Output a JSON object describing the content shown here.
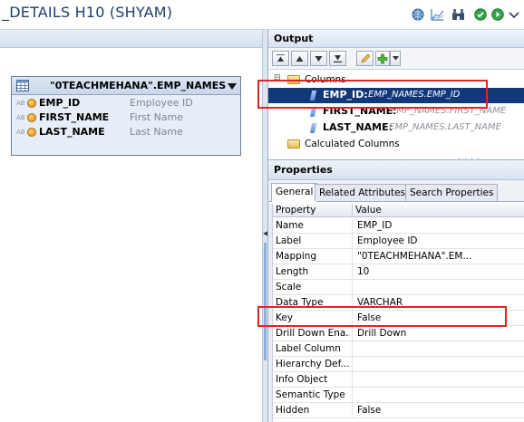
{
  "editor": {
    "title": "_DETAILS H10 (SHYAM)",
    "toolbar_icons": [
      "globe-icon",
      "chart-icon",
      "binoculars-icon",
      "check-icon",
      "run-icon",
      "menu-icon"
    ]
  },
  "canvas": {
    "table_node": {
      "title": "\"0TEACHMEHANA\".EMP_NAMES",
      "columns": [
        {
          "name": "EMP_ID",
          "label": "Employee ID",
          "type_glyph": "AB"
        },
        {
          "name": "FIRST_NAME",
          "label": "First Name",
          "type_glyph": "AB"
        },
        {
          "name": "LAST_NAME",
          "label": "Last Name",
          "type_glyph": "AB"
        }
      ]
    }
  },
  "output": {
    "title": "Output",
    "tree": {
      "columns_folder": "Columns",
      "columns": [
        {
          "name": "EMP_ID:",
          "mapping": "EMP_NAMES.EMP_ID",
          "selected": true
        },
        {
          "name": "FIRST_NAME:",
          "mapping": "EMP_NAMES.FIRST_NAME",
          "selected": false
        },
        {
          "name": "LAST_NAME:",
          "mapping": "EMP_NAMES.LAST_NAME",
          "selected": false
        }
      ],
      "calculated_folder": "Calculated Columns"
    }
  },
  "properties": {
    "title": "Properties",
    "tabs": [
      "General",
      "Related Attributes",
      "Search Properties"
    ],
    "active_tab": "General",
    "headers": {
      "property": "Property",
      "value": "Value"
    },
    "rows": [
      {
        "property": "Name",
        "value": "EMP_ID"
      },
      {
        "property": "Label",
        "value": "Employee ID"
      },
      {
        "property": "Mapping",
        "value": "\"0TEACHMEHANA\".EM..."
      },
      {
        "property": "Length",
        "value": "10"
      },
      {
        "property": "Scale",
        "value": ""
      },
      {
        "property": "Data Type",
        "value": "VARCHAR"
      },
      {
        "property": "Key",
        "value": "False"
      },
      {
        "property": "Drill Down Ena...",
        "value": "Drill Down"
      },
      {
        "property": "Label Column",
        "value": ""
      },
      {
        "property": "Hierarchy Def...",
        "value": ""
      },
      {
        "property": "Info Object",
        "value": ""
      },
      {
        "property": "Semantic Type",
        "value": ""
      },
      {
        "property": "Hidden",
        "value": "False"
      }
    ]
  },
  "colors": {
    "selection": "#12387a",
    "highlight": "#e02424",
    "title_text": "#1f3d6e"
  }
}
